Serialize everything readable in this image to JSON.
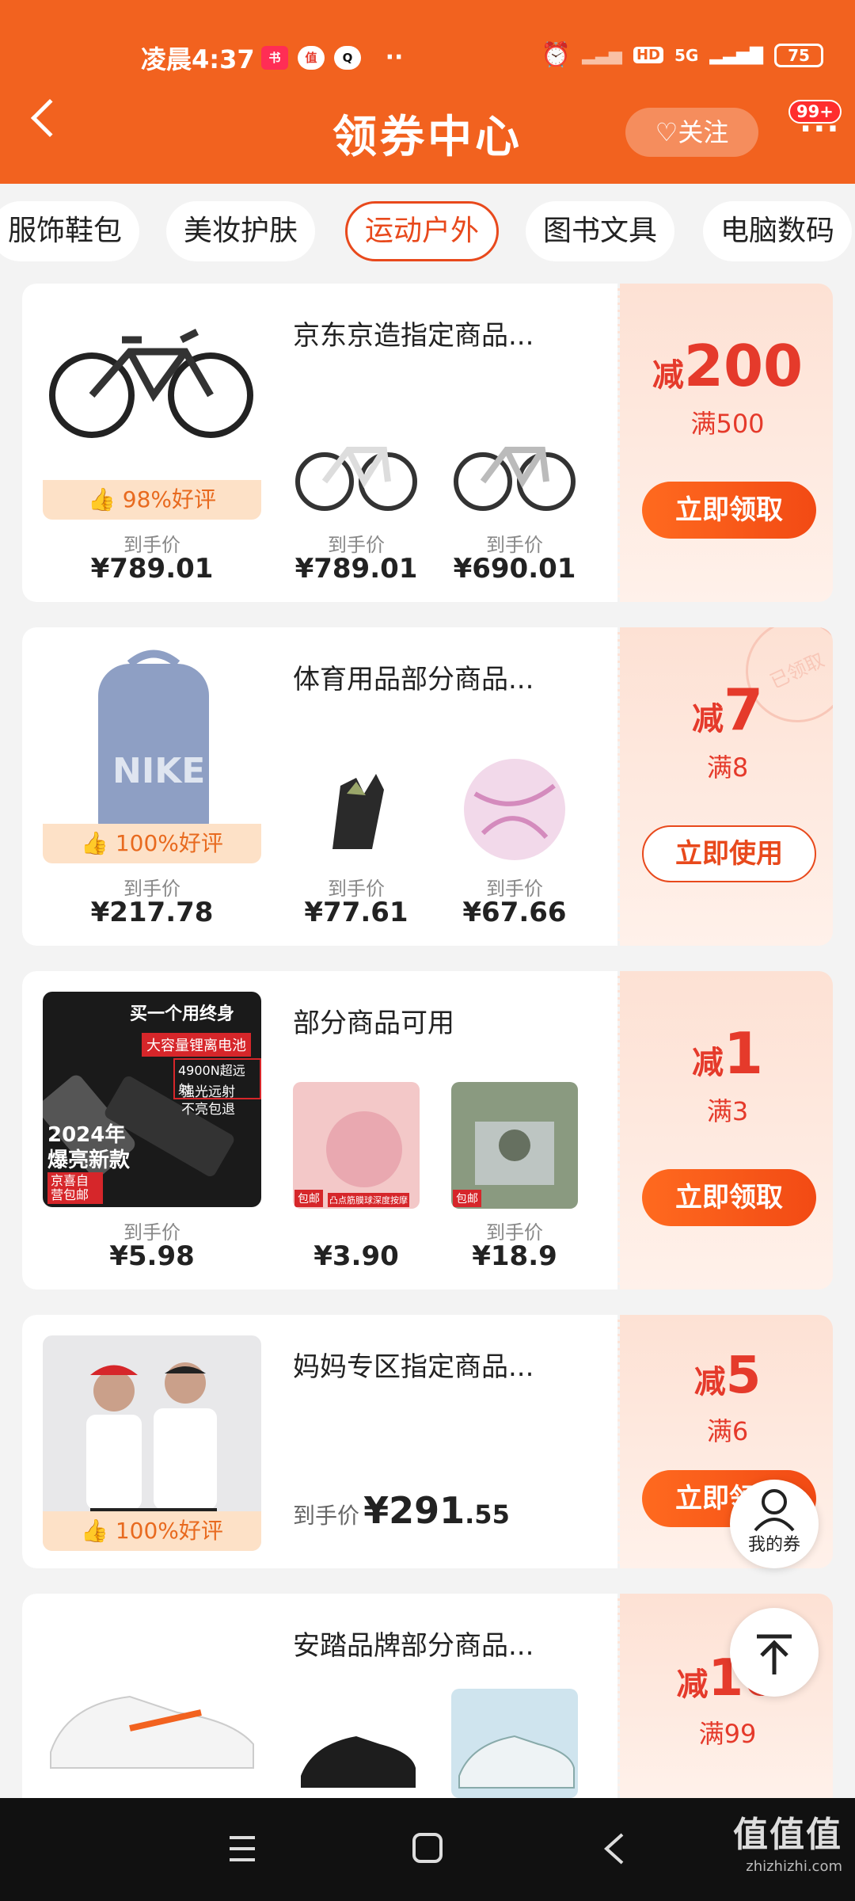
{
  "status_bar": {
    "time": "凌晨4:37",
    "icons": [
      "xiaohongshu-icon",
      "zhi-icon",
      "qq-icon"
    ],
    "dots": "··",
    "network": "5G",
    "hd": "HD",
    "battery": "75"
  },
  "header": {
    "title": "领券中心",
    "follow_label": "关注",
    "badge": "99+",
    "more": "···"
  },
  "tabs": [
    {
      "label": "服饰鞋包"
    },
    {
      "label": "美妆护肤"
    },
    {
      "label": "运动户外",
      "active": true
    },
    {
      "label": "图书文具"
    },
    {
      "label": "电脑数码"
    }
  ],
  "cards": [
    {
      "title": "京东京造指定商品...",
      "rating": "98%好评",
      "labels": [
        "到手价",
        "到手价",
        "到手价"
      ],
      "prices": [
        "¥789.01",
        "¥789.01",
        "¥690.01"
      ],
      "reduce": "减",
      "amount": "200",
      "condition": "满500",
      "button": "立即领取"
    },
    {
      "title": "体育用品部分商品...",
      "rating": "100%好评",
      "labels": [
        "到手价",
        "到手价",
        "到手价"
      ],
      "prices": [
        "¥217.78",
        "¥77.61",
        "¥67.66"
      ],
      "reduce": "减",
      "amount": "7",
      "condition": "满8",
      "button": "立即使用",
      "stamp": "已领取"
    },
    {
      "title": "部分商品可用",
      "labels": [
        "到手价",
        "到手价"
      ],
      "prices": [
        "¥5.98",
        "¥3.90",
        "¥18.9"
      ],
      "reduce": "减",
      "amount": "1",
      "condition": "满3",
      "button": "立即领取",
      "ad": {
        "line1": "买一个用终身",
        "line2": "大容量锂离电池",
        "line3": "4900N超远射",
        "line4": "强光远射",
        "line5": "不亮包退",
        "year": "2024年",
        "slogan": "爆亮新款",
        "tag": "京喜自营包邮"
      },
      "thumb_tags": [
        "包邮",
        "包邮"
      ],
      "thumb_caption": "凸点筋膜球深度按摩"
    },
    {
      "title": "妈妈专区指定商品...",
      "rating": "100%好评",
      "label": "到手价",
      "price_main": "¥291",
      "price_dec": ".55",
      "reduce": "减",
      "amount": "5",
      "condition": "满6",
      "button": "立即领取"
    },
    {
      "title": "安踏品牌部分商品...",
      "reduce": "减",
      "amount": "10",
      "condition": "满99"
    }
  ],
  "floating": {
    "my_coupons": "我的券"
  },
  "watermark": {
    "logo": "值值值",
    "site": "zhizhizhi.com"
  }
}
